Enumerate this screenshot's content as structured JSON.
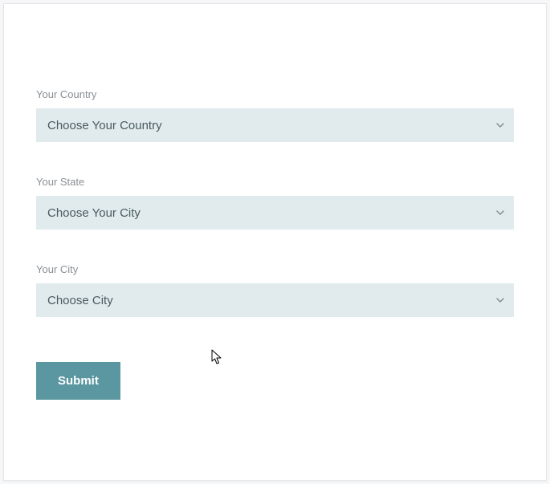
{
  "form": {
    "country": {
      "label": "Your Country",
      "selected": "Choose Your Country"
    },
    "state": {
      "label": "Your State",
      "selected": "Choose Your City"
    },
    "city": {
      "label": "Your City",
      "selected": "Choose City"
    },
    "submit_label": "Submit"
  }
}
